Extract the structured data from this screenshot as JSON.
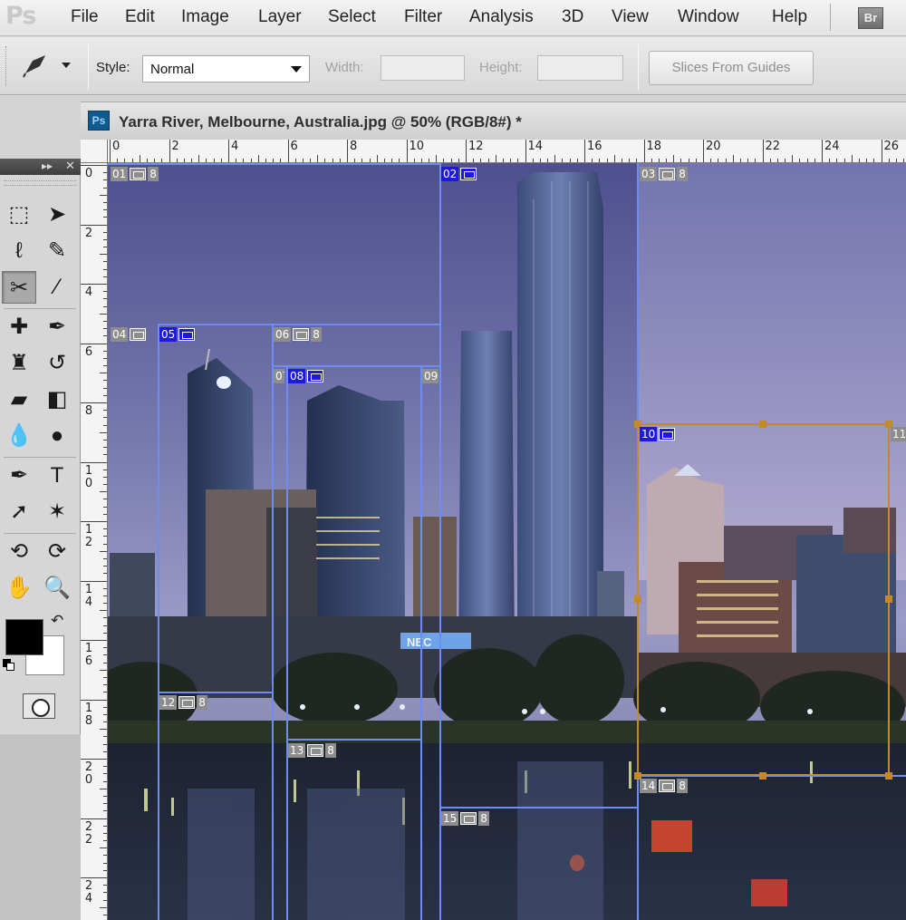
{
  "app": {
    "logo": "Ps"
  },
  "menu": [
    "File",
    "Edit",
    "Image",
    "Layer",
    "Select",
    "Filter",
    "Analysis",
    "3D",
    "View",
    "Window",
    "Help"
  ],
  "bridge_button": "Br",
  "options": {
    "style_label": "Style:",
    "style_value": "Normal",
    "width_label": "Width:",
    "height_label": "Height:",
    "slices_button": "Slices From Guides"
  },
  "document": {
    "ps_icon": "Ps",
    "title": "Yarra River, Melbourne, Australia.jpg @ 50% (RGB/8#) *"
  },
  "rulers": {
    "horizontal": [
      "0",
      "2",
      "4",
      "6",
      "8",
      "10",
      "12",
      "14",
      "16",
      "18",
      "20",
      "22",
      "24",
      "26"
    ],
    "vertical": [
      "0",
      "2",
      "4",
      "6",
      "8",
      "10",
      "12",
      "14",
      "16",
      "18",
      "20",
      "22",
      "24"
    ]
  },
  "slices": [
    {
      "num": "01",
      "kind": "auto",
      "link": "8"
    },
    {
      "num": "02",
      "kind": "user",
      "link": ""
    },
    {
      "num": "03",
      "kind": "auto",
      "link": "8"
    },
    {
      "num": "04",
      "kind": "auto",
      "link": ""
    },
    {
      "num": "05",
      "kind": "user",
      "link": ""
    },
    {
      "num": "06",
      "kind": "auto",
      "link": "8"
    },
    {
      "num": "07",
      "kind": "auto",
      "link": ""
    },
    {
      "num": "08",
      "kind": "user",
      "link": ""
    },
    {
      "num": "09",
      "kind": "auto",
      "link": ""
    },
    {
      "num": "10",
      "kind": "user",
      "link": ""
    },
    {
      "num": "11",
      "kind": "auto",
      "link": ""
    },
    {
      "num": "12",
      "kind": "auto",
      "link": "8"
    },
    {
      "num": "13",
      "kind": "auto",
      "link": "8"
    },
    {
      "num": "14",
      "kind": "auto",
      "link": "8"
    },
    {
      "num": "15",
      "kind": "auto",
      "link": "8"
    }
  ],
  "sign_text": "NEC",
  "colors": {
    "user_slice": "#1f1ad9",
    "auto_slice": "#8d8d8d",
    "slice_line": "#6d8ef0",
    "selected_slice": "#c4892a",
    "foreground": "#000000",
    "background": "#ffffff"
  }
}
